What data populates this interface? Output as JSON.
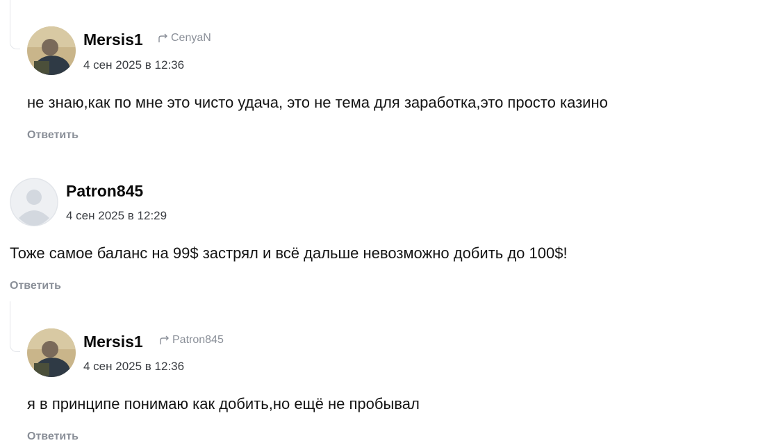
{
  "comments": [
    {
      "author": "Mersis1",
      "reply_to": "CenyaN",
      "date": "4 сен 2025 в 12:36",
      "text": "не знаю,как по мне это чисто удача, это не тема для заработка,это просто казино",
      "reply_label": "Ответить",
      "avatar": "user-photo"
    },
    {
      "author": "Patron845",
      "date": "4 сен 2025 в 12:29",
      "text": "Тоже самое баланс на 99$ застрял и всё дальше невозможно добить до 100$!",
      "reply_label": "Ответить",
      "avatar": "default-user"
    },
    {
      "author": "Mersis1",
      "reply_to": "Patron845",
      "date": "4 сен 2025 в 12:36",
      "text": "я в принципе понимаю как добить,но ещё не пробывал",
      "reply_label": "Ответить",
      "avatar": "user-photo"
    }
  ],
  "colors": {
    "muted": "#8a8f98",
    "thread_line": "#e3e5ea",
    "text": "#141414"
  }
}
